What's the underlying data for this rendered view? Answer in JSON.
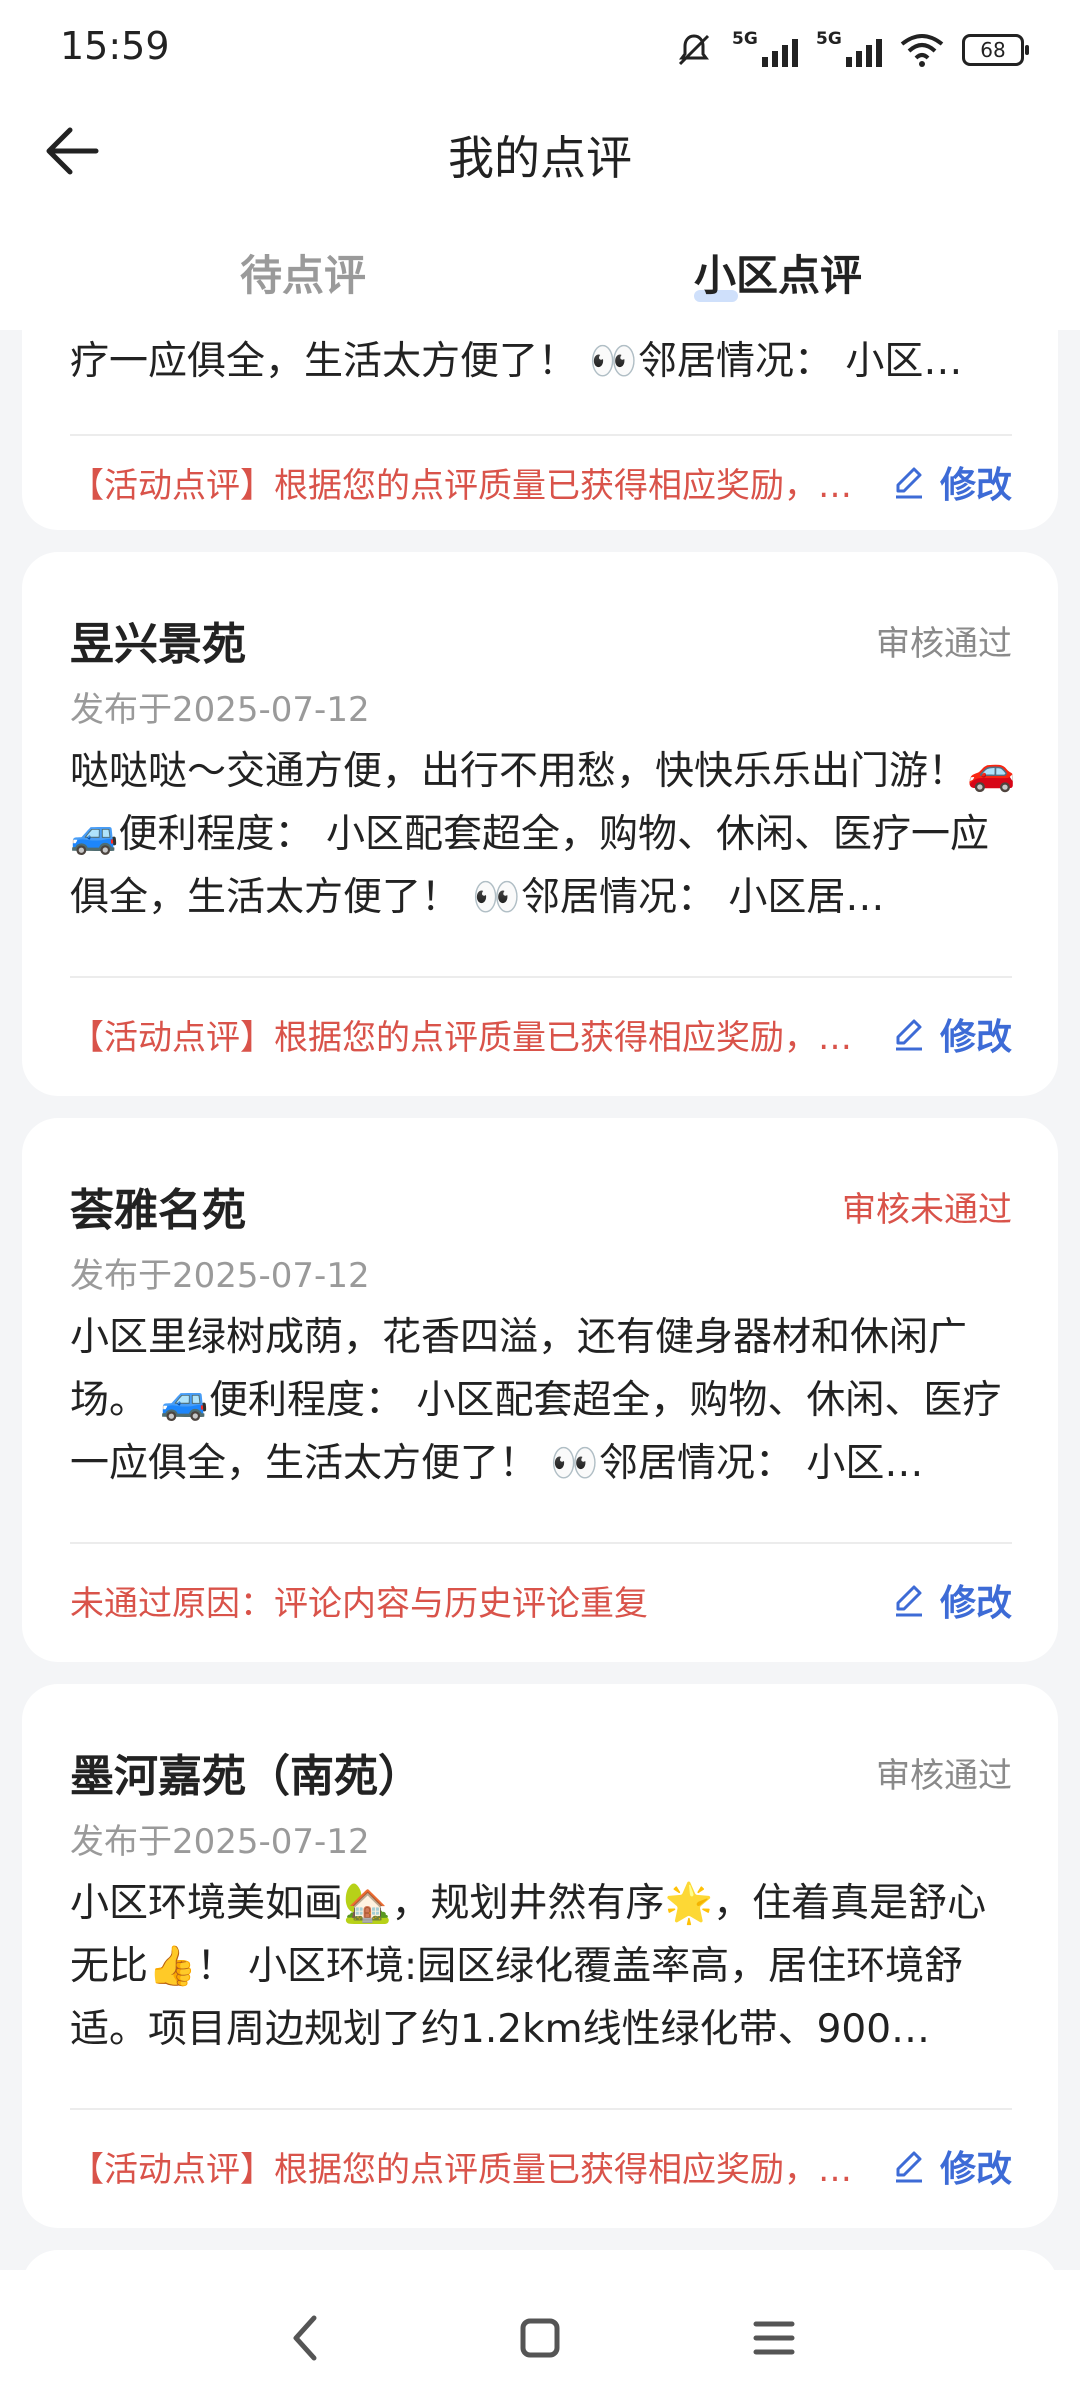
{
  "status_bar": {
    "time": "15:59",
    "net1": "5G",
    "net2": "5G",
    "battery": "68"
  },
  "header": {
    "title": "我的点评"
  },
  "tabs": [
    {
      "label": "待点评"
    },
    {
      "label": "小区点评"
    }
  ],
  "cards": [
    {
      "body": "疗一应俱全，生活太方便了！ 👀邻居情况： 小区…",
      "note": "【活动点评】根据您的点评质量已获得相应奖励，…",
      "edit_label": "修改"
    },
    {
      "name": "昱兴景苑",
      "status": "审核通过",
      "date": "发布于2025-07-12",
      "body": "哒哒哒～交通方便，出行不用愁，快快乐乐出门游！🚗 🚙便利程度： 小区配套超全，购物、休闲、医疗一应俱全，生活太方便了！ 👀邻居情况： 小区居…",
      "note": "【活动点评】根据您的点评质量已获得相应奖励，…",
      "edit_label": "修改"
    },
    {
      "name": "荟雅名苑",
      "status": "审核未通过",
      "date": "发布于2025-07-12",
      "body": "小区里绿树成荫，花香四溢，还有健身器材和休闲广场。 🚙便利程度： 小区配套超全，购物、休闲、医疗一应俱全，生活太方便了！ 👀邻居情况： 小区…",
      "note": "未通过原因：评论内容与历史评论重复",
      "edit_label": "修改"
    },
    {
      "name": "墨河嘉苑（南苑）",
      "status": "审核通过",
      "date": "发布于2025-07-12",
      "body": "小区环境美如画🏡，规划井然有序🌟，住着真是舒心无比👍！ 小区环境:园区绿化覆盖率高，居住环境舒适。项目周边规划了约1.2km线性绿化带、900…",
      "note": "【活动点评】根据您的点评质量已获得相应奖励，…",
      "edit_label": "修改"
    }
  ]
}
